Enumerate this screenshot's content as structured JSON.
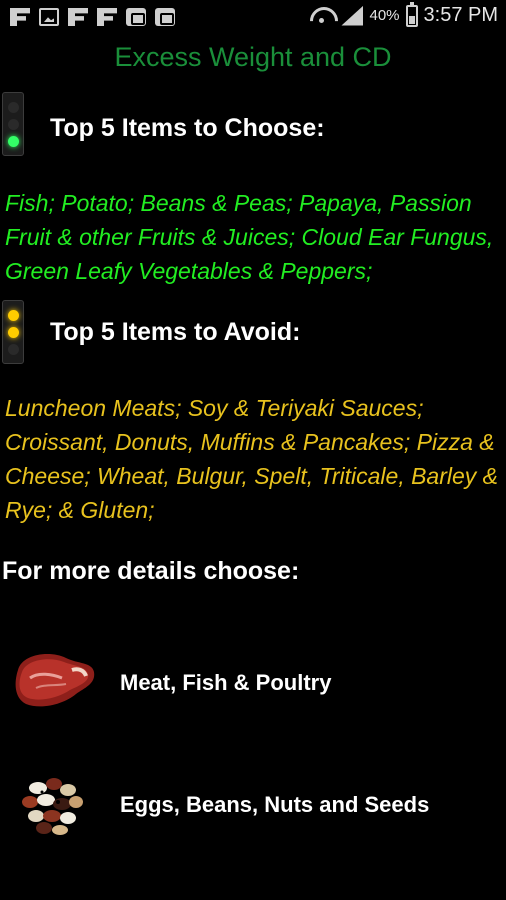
{
  "status_bar": {
    "battery": "40%",
    "time": "3:57 PM"
  },
  "title": "Excess Weight and CD",
  "choose": {
    "heading": "Top 5 Items to Choose:",
    "items": "Fish; Potato; Beans & Peas; Papaya, Passion Fruit & other Fruits & Juices; Cloud Ear Fungus, Green Leafy Vegetables & Peppers;"
  },
  "avoid": {
    "heading": "Top 5 Items to Avoid:",
    "items": "Luncheon Meats; Soy & Teriyaki Sauces; Croissant, Donuts, Muffins & Pancakes; Pizza & Cheese; Wheat, Bulgur, Spelt, Triticale, Barley & Rye; & Gluten;"
  },
  "more_details": "For more details choose:",
  "categories": [
    {
      "label": "Meat, Fish & Poultry",
      "icon": "steak-icon"
    },
    {
      "label": "Eggs, Beans, Nuts and Seeds",
      "icon": "beans-icon"
    }
  ],
  "colors": {
    "title": "#1a8f3a",
    "choose_text": "#22ee22",
    "avoid_text": "#e8c21e",
    "background": "#000000"
  }
}
